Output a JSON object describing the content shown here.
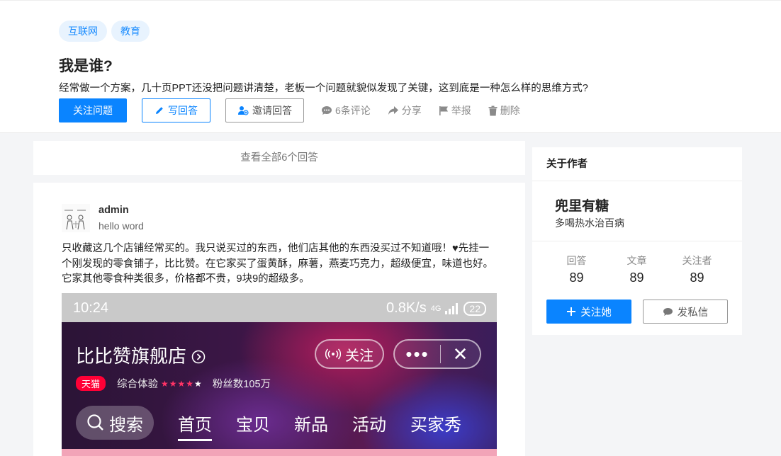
{
  "question": {
    "tags": [
      "互联网",
      "教育"
    ],
    "title": "我是谁?",
    "description": "经常做一个方案，几十页PPT还没把问题讲清楚，老板一个问题就貌似发现了关键，这到底是一种怎么样的思维方式?",
    "actions": {
      "follow": "关注问题",
      "write": "写回答",
      "invite": "邀请回答",
      "comments": "6条评论",
      "share": "分享",
      "report": "举报",
      "delete": "删除"
    }
  },
  "view_all": "查看全部6个回答",
  "answer": {
    "author_name": "admin",
    "author_signature": "hello word",
    "text": "只收藏这几个店铺经常买的。我只说买过的东西，他们店其他的东西没买过不知道哦！♥先挂一个刚发现的零食铺子，比比赞。在它家买了蛋黄酥，麻薯，燕麦巧克力，超级便宜，味道也好。它家其他零食种类很多，价格都不贵，9块9的超级多。",
    "screenshot": {
      "time": "10:24",
      "speed": "0.8K/s",
      "network": "4G",
      "battery": "22",
      "shop_name": "比比赞旗舰店",
      "follow": "关注",
      "more": "•••",
      "close": "✕",
      "badge": "天猫",
      "rating_label": "综合体验",
      "stars": "★★★★",
      "star_last": "★",
      "fans": "粉丝数105万",
      "search": "搜索",
      "nav": [
        "首页",
        "宝贝",
        "新品",
        "活动",
        "买家秀"
      ]
    }
  },
  "author_card": {
    "heading": "关于作者",
    "name": "兜里有糖",
    "signature": "多喝热水治百病",
    "stats": [
      {
        "label": "回答",
        "value": "89"
      },
      {
        "label": "文章",
        "value": "89"
      },
      {
        "label": "关注者",
        "value": "89"
      }
    ],
    "follow": "关注她",
    "message": "发私信"
  },
  "colors": {
    "accent": "#0a84ff",
    "tag_bg": "#e8f3fe",
    "tmall": "#ff0036"
  },
  "icons": [
    "pencil-icon",
    "invite-user-icon",
    "comment-icon",
    "share-icon",
    "flag-icon",
    "trash-icon",
    "plus-icon",
    "chat-icon"
  ]
}
